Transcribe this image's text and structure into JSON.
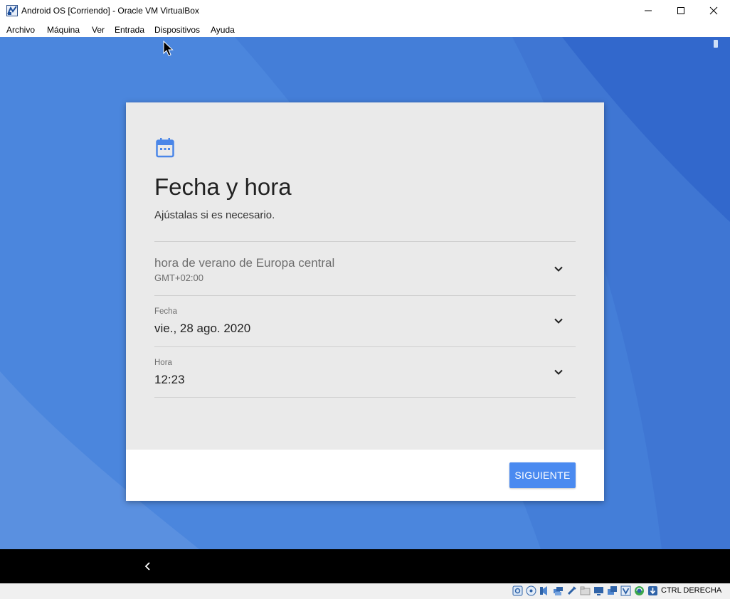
{
  "window": {
    "title": "Android OS [Corriendo] - Oracle VM VirtualBox"
  },
  "menu": {
    "items": [
      "Archivo",
      "Máquina",
      "Ver",
      "Entrada",
      "Dispositivos",
      "Ayuda"
    ]
  },
  "dialog": {
    "icon": "calendar-icon",
    "title": "Fecha y hora",
    "subtitle": "Ajústalas si es necesario.",
    "timezone": {
      "name": "hora de verano de Europa central",
      "offset": "GMT+02:00"
    },
    "date": {
      "label": "Fecha",
      "value": "vie., 28 ago. 2020"
    },
    "time": {
      "label": "Hora",
      "value": "12:23"
    },
    "next_button": "SIGUIENTE"
  },
  "statusbar": {
    "host_key": "CTRL DERECHA",
    "icons": [
      "hard-disk-icon",
      "optical-disk-icon",
      "audio-icon",
      "network-icon",
      "usb-icon",
      "shared-folder-icon",
      "display-icon",
      "recording-icon",
      "vt-x-icon",
      "cpu-icon",
      "mouse-integration-icon"
    ]
  },
  "colors": {
    "desktop_blue": "#4b86dd",
    "accent": "#4a8af0",
    "dialog_bg": "#eaeaea"
  }
}
